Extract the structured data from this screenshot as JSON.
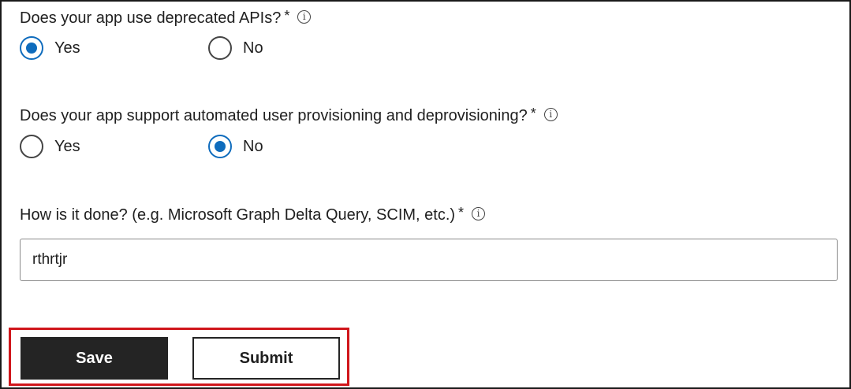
{
  "q1": {
    "text": "Does your app use deprecated APIs?",
    "required": "*",
    "options": [
      {
        "label": "Yes",
        "selected": true
      },
      {
        "label": "No",
        "selected": false
      }
    ]
  },
  "q2": {
    "text": "Does your app support automated user provisioning and deprovisioning?",
    "required": "*",
    "options": [
      {
        "label": "Yes",
        "selected": false
      },
      {
        "label": "No",
        "selected": true
      }
    ]
  },
  "q3": {
    "text": "How is it done? (e.g. Microsoft Graph Delta Query, SCIM, etc.)",
    "required": "*",
    "value": "rthrtjr"
  },
  "actions": {
    "save_label": "Save",
    "submit_label": "Submit"
  },
  "colors": {
    "accent": "#0f6cbd",
    "primary_button": "#242424",
    "highlight_border": "#d0161b"
  }
}
